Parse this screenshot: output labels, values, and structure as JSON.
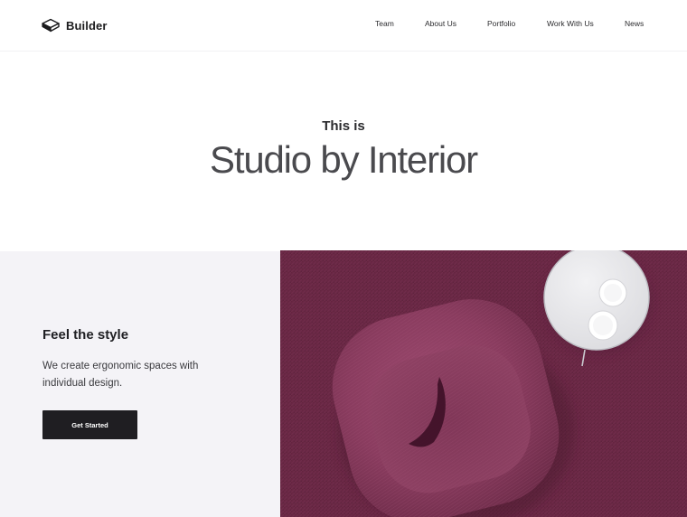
{
  "header": {
    "brand": "Builder",
    "brand_icon": "cube-logo-icon",
    "nav": [
      "Team",
      "About Us",
      "Portfolio",
      "Work With Us",
      "News"
    ]
  },
  "hero": {
    "kicker": "This is",
    "title": "Studio by Interior"
  },
  "feature": {
    "title": "Feel the style",
    "description": "We create ergonomic spaces with individual design.",
    "cta_label": "Get Started",
    "image_subject": "armchair-top-view-image"
  },
  "colors": {
    "background": "#ffffff",
    "panel": "#f4f3f7",
    "button": "#1f1e22",
    "accent_plum": "#6b2846"
  }
}
